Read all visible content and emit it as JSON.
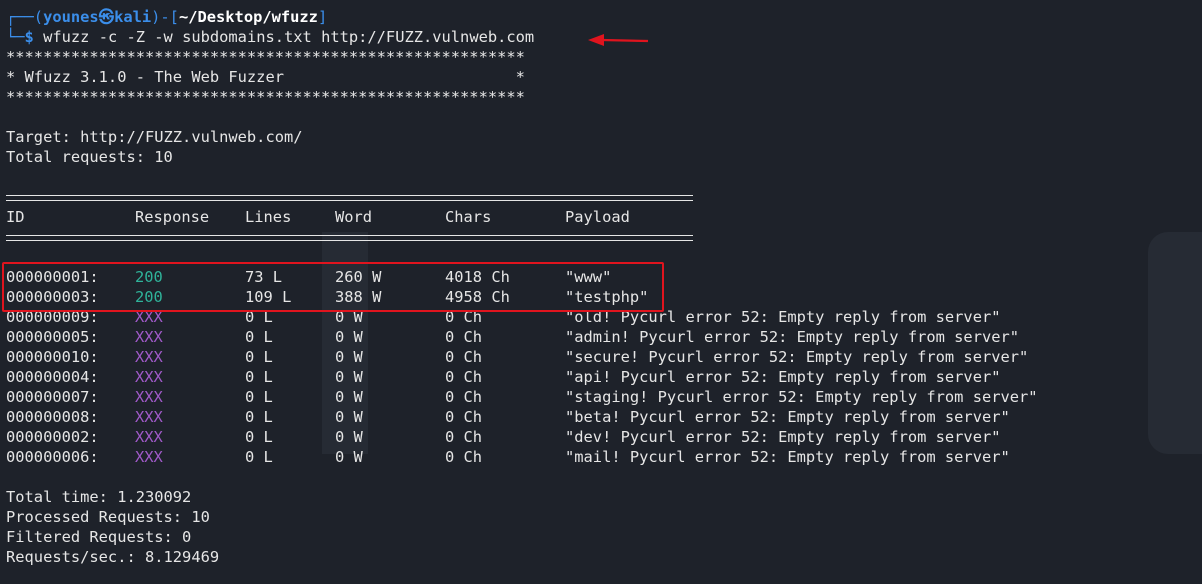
{
  "prompt": {
    "top_left": "┌──(",
    "user": "younes㉿kali",
    "mid": ")-[",
    "path": "~/Desktop/wfuzz",
    "end": "]",
    "bottom_left": "└─",
    "dollar": "$",
    "command": " wfuzz -c -Z -w subdomains.txt http://FUZZ.vulnweb.com"
  },
  "banner": {
    "stars": "********************************************************",
    "title": "* Wfuzz 3.1.0 - The Web Fuzzer                         *"
  },
  "info": {
    "target": "Target: http://FUZZ.vulnweb.com/",
    "total": "Total requests: 10"
  },
  "table": {
    "headers": {
      "id": "ID",
      "response": "Response",
      "lines": "Lines",
      "word": "Word",
      "chars": "Chars",
      "payload": "Payload"
    },
    "rows": [
      {
        "id": "000000001:",
        "response": "200",
        "lines": "73 L",
        "word": "260 W",
        "chars": "4018 Ch",
        "payload": "\"www\""
      },
      {
        "id": "000000003:",
        "response": "200",
        "lines": "109 L",
        "word": "388 W",
        "chars": "4958 Ch",
        "payload": "\"testphp\""
      },
      {
        "id": "000000009:",
        "response": "XXX",
        "lines": "0 L",
        "word": "0 W",
        "chars": "0 Ch",
        "payload": "\"old! Pycurl error 52: Empty reply from server\""
      },
      {
        "id": "000000005:",
        "response": "XXX",
        "lines": "0 L",
        "word": "0 W",
        "chars": "0 Ch",
        "payload": "\"admin! Pycurl error 52: Empty reply from server\""
      },
      {
        "id": "000000010:",
        "response": "XXX",
        "lines": "0 L",
        "word": "0 W",
        "chars": "0 Ch",
        "payload": "\"secure! Pycurl error 52: Empty reply from server\""
      },
      {
        "id": "000000004:",
        "response": "XXX",
        "lines": "0 L",
        "word": "0 W",
        "chars": "0 Ch",
        "payload": "\"api! Pycurl error 52: Empty reply from server\""
      },
      {
        "id": "000000007:",
        "response": "XXX",
        "lines": "0 L",
        "word": "0 W",
        "chars": "0 Ch",
        "payload": "\"staging! Pycurl error 52: Empty reply from server\""
      },
      {
        "id": "000000008:",
        "response": "XXX",
        "lines": "0 L",
        "word": "0 W",
        "chars": "0 Ch",
        "payload": "\"beta! Pycurl error 52: Empty reply from server\""
      },
      {
        "id": "000000002:",
        "response": "XXX",
        "lines": "0 L",
        "word": "0 W",
        "chars": "0 Ch",
        "payload": "\"dev! Pycurl error 52: Empty reply from server\""
      },
      {
        "id": "000000006:",
        "response": "XXX",
        "lines": "0 L",
        "word": "0 W",
        "chars": "0 Ch",
        "payload": "\"mail! Pycurl error 52: Empty reply from server\""
      }
    ]
  },
  "summary": {
    "time": "Total time: 1.230092",
    "processed": "Processed Requests: 10",
    "filtered": "Filtered Requests: 0",
    "rate": "Requests/sec.: 8.129469"
  },
  "colors": {
    "ok": "#2fb39a",
    "xxx": "#a05ac8",
    "annotation": "#e0141e",
    "prompt": "#3b8eea"
  }
}
